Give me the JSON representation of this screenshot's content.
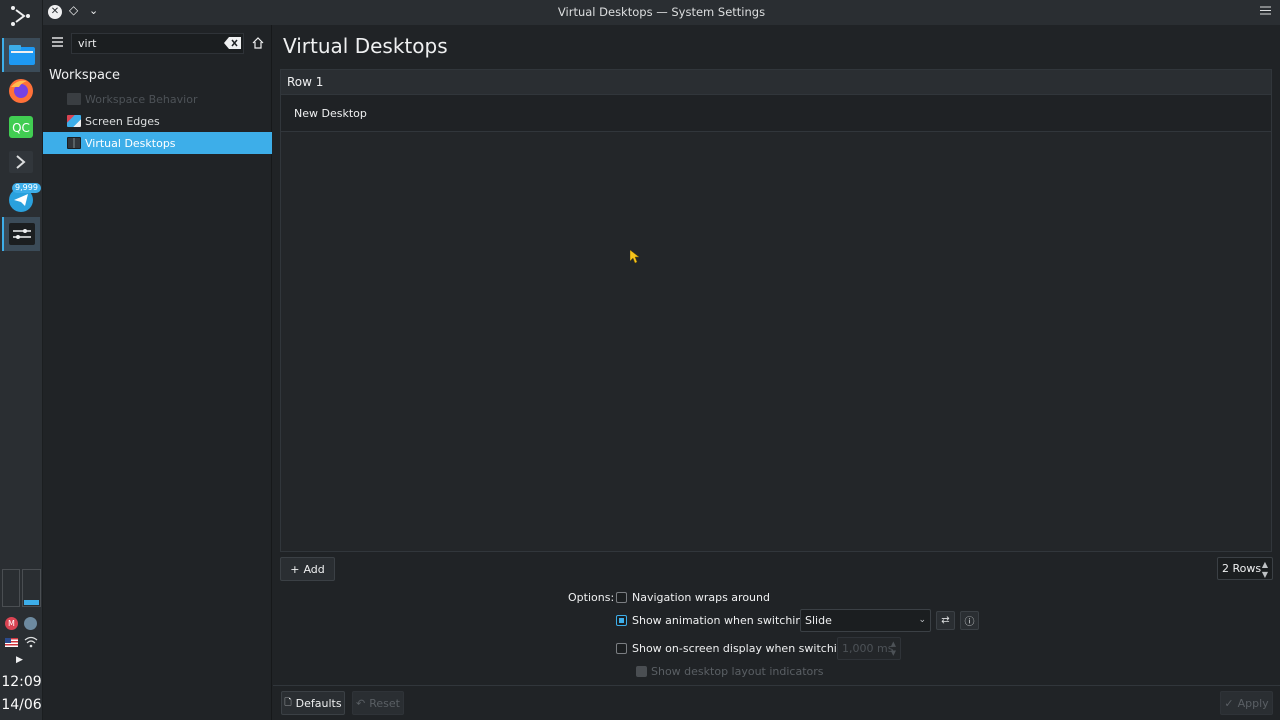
{
  "window": {
    "title": "Virtual Desktops — System Settings"
  },
  "dock": {
    "telegram_badge": "9,999",
    "clock": "12:09",
    "date": "14/06"
  },
  "sidebar": {
    "search_value": "virt",
    "heading": "Workspace",
    "items": [
      {
        "label": "Workspace Behavior",
        "state": "disabled"
      },
      {
        "label": "Screen Edges",
        "state": "normal"
      },
      {
        "label": "Virtual Desktops",
        "state": "selected"
      }
    ]
  },
  "main": {
    "title": "Virtual Desktops",
    "row_header": "Row 1",
    "desktops": [
      "New Desktop"
    ],
    "add_label": "Add",
    "rows_value": "2 Rows",
    "options": {
      "label": "Options:",
      "nav_wraps": "Navigation wraps around",
      "show_animation": "Show animation when switchin...",
      "animation_value": "Slide",
      "show_osd": "Show on-screen display when switching:",
      "osd_duration": "1,000 ms",
      "show_layout_indicators": "Show desktop layout indicators"
    },
    "footer": {
      "defaults": "Defaults",
      "reset": "Reset",
      "apply": "Apply"
    }
  },
  "colors": {
    "accent": "#3daee9",
    "bg": "#202326",
    "panel": "#2a2e32"
  }
}
